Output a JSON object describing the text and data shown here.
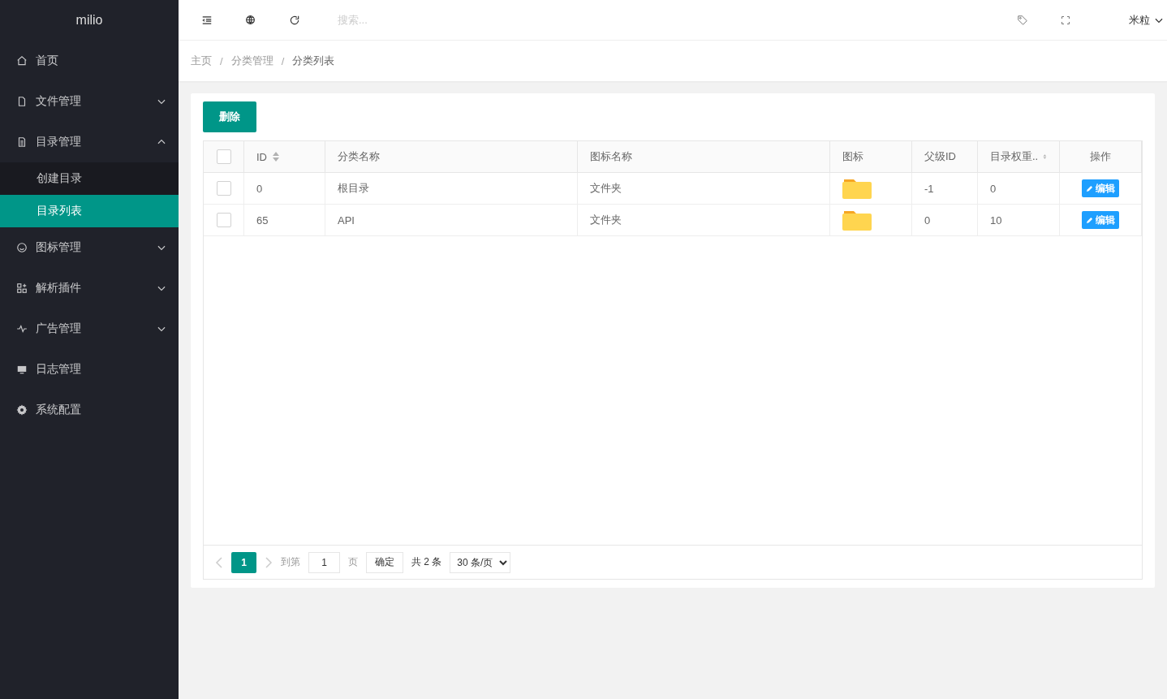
{
  "sidebar": {
    "logo": "milio",
    "items": [
      {
        "label": "首页",
        "selected": false
      },
      {
        "label": "文件管理",
        "selected": false,
        "expanded": false
      },
      {
        "label": "目录管理",
        "selected": false,
        "expanded": true,
        "children": [
          {
            "label": "创建目录",
            "selected": false
          },
          {
            "label": "目录列表",
            "selected": true
          }
        ]
      },
      {
        "label": "图标管理",
        "selected": false,
        "expanded": false
      },
      {
        "label": "解析插件",
        "selected": false,
        "expanded": false
      },
      {
        "label": "广告管理",
        "selected": false,
        "expanded": false
      },
      {
        "label": "日志管理",
        "selected": false
      },
      {
        "label": "系统配置",
        "selected": false
      }
    ]
  },
  "header": {
    "search": {
      "placeholder": "搜索..."
    },
    "user": "米粒"
  },
  "breadcrumb": {
    "items": [
      "主页",
      "分类管理",
      "分类列表"
    ],
    "separators": [
      "/",
      "/"
    ]
  },
  "toolbar": {
    "delete_button": "删除"
  },
  "table": {
    "select_all": {
      "checked": false
    },
    "columns": [
      {
        "label": "ID",
        "sortable": true
      },
      {
        "label": "分类名称",
        "sortable": false
      },
      {
        "label": "图标名称",
        "sortable": false
      },
      {
        "label": "图标",
        "sortable": false
      },
      {
        "label": "父级ID",
        "sortable": false
      },
      {
        "label": "目录权重..",
        "sortable": true
      },
      {
        "label": "操作",
        "sortable": false
      }
    ],
    "rows": [
      {
        "checked": false,
        "id": "0",
        "name": "根目录",
        "icon_name": "文件夹",
        "parent_id": "-1",
        "weight": "0",
        "action": "编辑"
      },
      {
        "checked": false,
        "id": "65",
        "name": "API",
        "icon_name": "文件夹",
        "parent_id": "0",
        "weight": "10",
        "action": "编辑"
      }
    ]
  },
  "pagination": {
    "pages": [
      {
        "label": "1",
        "selected": true
      }
    ],
    "goto_label": "到第",
    "goto_value": "1",
    "page_unit": "页",
    "confirm": "确定",
    "total": "共 2 条",
    "page_size": "30 条/页"
  }
}
